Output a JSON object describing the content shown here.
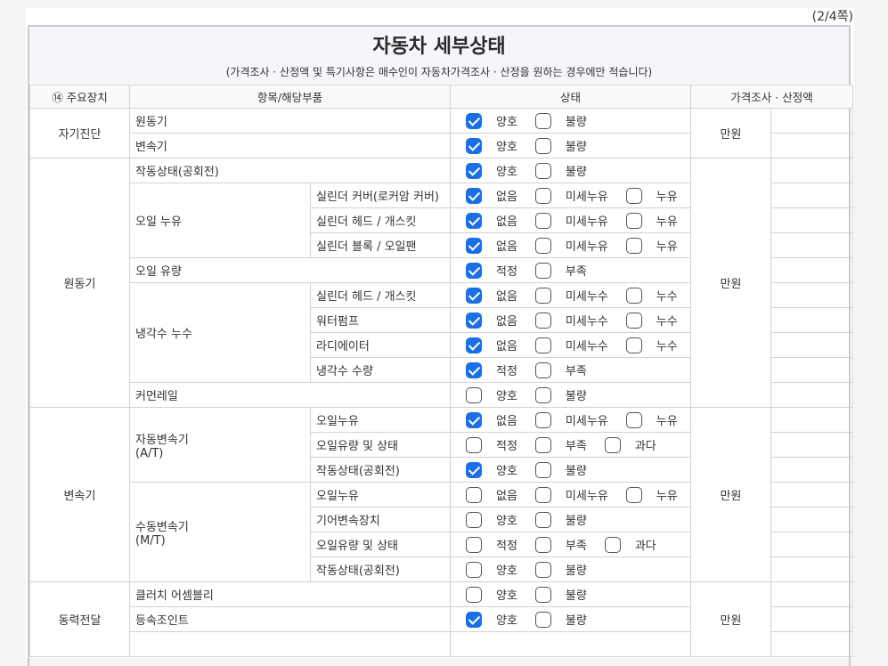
{
  "page_number": "(2/4쪽)",
  "title": "자동차 세부상태",
  "subtitle": "(가격조사 · 산정액 및 특기사항은 매수인이 자동차가격조사 · 산정을 원하는 경우에만 적습니다)",
  "header": {
    "col1": "⑭ 주요장치",
    "col2": "항목/해당부품",
    "col3": "상태",
    "col4": "가격조사 · 산정액"
  },
  "sections": {
    "self_diag": {
      "label": "자기진단",
      "price": "만원",
      "rows": [
        {
          "item": "원동기",
          "options": [
            {
              "label": "양호",
              "checked": true
            },
            {
              "label": "불량",
              "checked": false
            }
          ]
        },
        {
          "item": "변속기",
          "options": [
            {
              "label": "양호",
              "checked": true
            },
            {
              "label": "불량",
              "checked": false
            }
          ]
        }
      ]
    },
    "engine": {
      "label": "원동기",
      "price": "만원",
      "operation": {
        "item": "작동상태(공회전)",
        "options": [
          {
            "label": "양호",
            "checked": true
          },
          {
            "label": "불량",
            "checked": false
          }
        ]
      },
      "oil_leak": {
        "label": "오일 누유",
        "rows": [
          {
            "sub": "실린더 커버(로커암 커버)",
            "options": [
              {
                "label": "없음",
                "checked": true
              },
              {
                "label": "미세누유",
                "checked": false
              },
              {
                "label": "누유",
                "checked": false
              }
            ]
          },
          {
            "sub": "실린더 헤드 / 개스킷",
            "options": [
              {
                "label": "없음",
                "checked": true
              },
              {
                "label": "미세누유",
                "checked": false
              },
              {
                "label": "누유",
                "checked": false
              }
            ]
          },
          {
            "sub": "실린더 블록 / 오일팬",
            "options": [
              {
                "label": "없음",
                "checked": true
              },
              {
                "label": "미세누유",
                "checked": false
              },
              {
                "label": "누유",
                "checked": false
              }
            ]
          }
        ]
      },
      "oil_level": {
        "item": "오일 유량",
        "options": [
          {
            "label": "적정",
            "checked": true
          },
          {
            "label": "부족",
            "checked": false
          }
        ]
      },
      "coolant_leak": {
        "label": "냉각수 누수",
        "rows": [
          {
            "sub": "실린더 헤드 / 개스킷",
            "options": [
              {
                "label": "없음",
                "checked": true
              },
              {
                "label": "미세누수",
                "checked": false
              },
              {
                "label": "누수",
                "checked": false
              }
            ]
          },
          {
            "sub": "워터펌프",
            "options": [
              {
                "label": "없음",
                "checked": true
              },
              {
                "label": "미세누수",
                "checked": false
              },
              {
                "label": "누수",
                "checked": false
              }
            ]
          },
          {
            "sub": "라디에이터",
            "options": [
              {
                "label": "없음",
                "checked": true
              },
              {
                "label": "미세누수",
                "checked": false
              },
              {
                "label": "누수",
                "checked": false
              }
            ]
          },
          {
            "sub": "냉각수 수량",
            "options": [
              {
                "label": "적정",
                "checked": true
              },
              {
                "label": "부족",
                "checked": false
              }
            ]
          }
        ]
      },
      "common_rail": {
        "item": "커먼레일",
        "options": [
          {
            "label": "양호",
            "checked": false
          },
          {
            "label": "불량",
            "checked": false
          }
        ]
      }
    },
    "transmission": {
      "label": "변속기",
      "price": "만원",
      "auto": {
        "label": "자동변속기\n(A/T)",
        "rows": [
          {
            "sub": "오일누유",
            "options": [
              {
                "label": "없음",
                "checked": true
              },
              {
                "label": "미세누유",
                "checked": false
              },
              {
                "label": "누유",
                "checked": false
              }
            ]
          },
          {
            "sub": "오일유량 및 상태",
            "options": [
              {
                "label": "적정",
                "checked": false
              },
              {
                "label": "부족",
                "checked": false
              },
              {
                "label": "과다",
                "checked": false
              }
            ]
          },
          {
            "sub": "작동상태(공회전)",
            "options": [
              {
                "label": "양호",
                "checked": true
              },
              {
                "label": "불량",
                "checked": false
              }
            ]
          }
        ]
      },
      "manual": {
        "label": "수동변속기\n(M/T)",
        "rows": [
          {
            "sub": "오일누유",
            "options": [
              {
                "label": "없음",
                "checked": false
              },
              {
                "label": "미세누유",
                "checked": false
              },
              {
                "label": "누유",
                "checked": false
              }
            ]
          },
          {
            "sub": "기어변속장치",
            "options": [
              {
                "label": "양호",
                "checked": false
              },
              {
                "label": "불량",
                "checked": false
              }
            ]
          },
          {
            "sub": "오일유량 및 상태",
            "options": [
              {
                "label": "적정",
                "checked": false
              },
              {
                "label": "부족",
                "checked": false
              },
              {
                "label": "과다",
                "checked": false
              }
            ]
          },
          {
            "sub": "작동상태(공회전)",
            "options": [
              {
                "label": "양호",
                "checked": false
              },
              {
                "label": "불량",
                "checked": false
              }
            ]
          }
        ]
      }
    },
    "power": {
      "label": "동력전달",
      "price": "만원",
      "rows": [
        {
          "item": "클러치 어셈블리",
          "options": [
            {
              "label": "양호",
              "checked": false
            },
            {
              "label": "불량",
              "checked": false
            }
          ]
        },
        {
          "item": "등속조인트",
          "options": [
            {
              "label": "양호",
              "checked": true
            },
            {
              "label": "불량",
              "checked": false
            }
          ]
        }
      ]
    }
  }
}
